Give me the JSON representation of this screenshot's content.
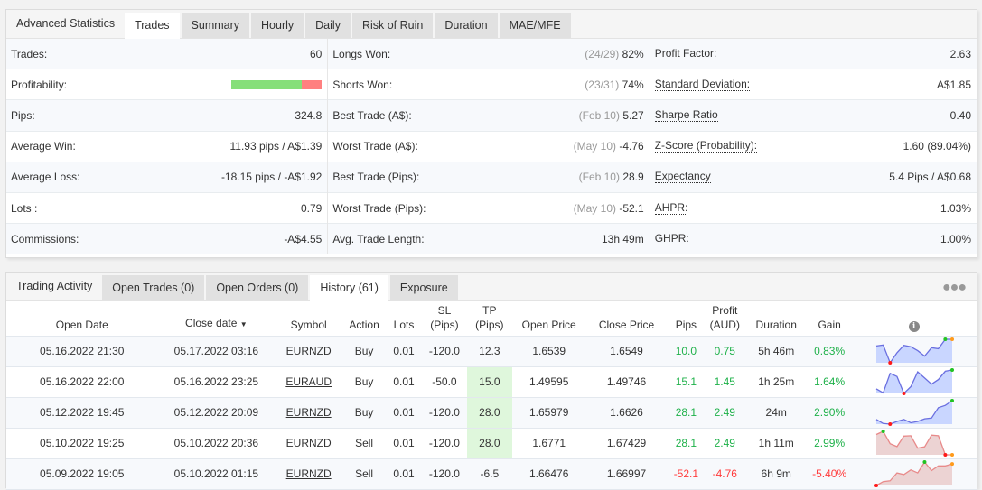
{
  "stats_panel": {
    "title": "Advanced Statistics",
    "tabs": [
      "Trades",
      "Summary",
      "Hourly",
      "Daily",
      "Risk of Ruin",
      "Duration",
      "MAE/MFE"
    ],
    "active_tab": "Trades",
    "col1": [
      {
        "label": "Trades:",
        "value": "60"
      },
      {
        "label": "Profitability:",
        "win_fraction": 0.78
      },
      {
        "label": "Pips:",
        "value": "324.8"
      },
      {
        "label": "Average Win:",
        "value": "11.93 pips / A$1.39"
      },
      {
        "label": "Average Loss:",
        "value": "-18.15 pips / -A$1.92"
      },
      {
        "label": "Lots :",
        "value": "0.79"
      },
      {
        "label": "Commissions:",
        "value": "-A$4.55"
      }
    ],
    "col2": [
      {
        "label": "Longs Won:",
        "muted": "(24/29)",
        "value": "82%"
      },
      {
        "label": "Shorts Won:",
        "muted": "(23/31)",
        "value": "74%"
      },
      {
        "label": "Best Trade (A$):",
        "muted": "(Feb 10)",
        "value": "5.27"
      },
      {
        "label": "Worst Trade (A$):",
        "muted": "(May 10)",
        "value": "-4.76"
      },
      {
        "label": "Best Trade (Pips):",
        "muted": "(Feb 10)",
        "value": "28.9"
      },
      {
        "label": "Worst Trade (Pips):",
        "muted": "(May 10)",
        "value": "-52.1"
      },
      {
        "label": "Avg. Trade Length:",
        "muted": "",
        "value": "13h 49m"
      }
    ],
    "col3": [
      {
        "label": "Profit Factor:",
        "value": "2.63"
      },
      {
        "label": "Standard Deviation:",
        "value": "A$1.85"
      },
      {
        "label": "Sharpe Ratio",
        "value": "0.40"
      },
      {
        "label": "Z-Score (Probability):",
        "value": "1.60 (89.04%)"
      },
      {
        "label": "Expectancy",
        "value": "5.4 Pips / A$0.68"
      },
      {
        "label": "AHPR:",
        "value": "1.03%"
      },
      {
        "label": "GHPR:",
        "value": "1.00%"
      }
    ]
  },
  "activity_panel": {
    "title": "Trading Activity",
    "tabs": [
      "Open Trades (0)",
      "Open Orders (0)",
      "History (61)",
      "Exposure"
    ],
    "active_tab": "History (61)",
    "more_icon": "more-dots-icon",
    "columns": {
      "open_date": "Open Date",
      "close_date": "Close date",
      "sort_indicator": "▼",
      "symbol": "Symbol",
      "action": "Action",
      "lots": "Lots",
      "sl_top": "SL",
      "sl_bottom": "(Pips)",
      "tp_top": "TP",
      "tp_bottom": "(Pips)",
      "open_price": "Open Price",
      "close_price": "Close Price",
      "pips": "Pips",
      "profit_top": "Profit",
      "profit_bottom": "(AUD)",
      "duration": "Duration",
      "gain": "Gain",
      "info_icon": "i"
    },
    "rows": [
      {
        "open_date": "05.16.2022 21:30",
        "close_date": "05.17.2022 03:16",
        "symbol": "EURNZD",
        "action": "Buy",
        "lots": "0.01",
        "sl": "-120.0",
        "tp": "12.3",
        "tp_hit": false,
        "open_price": "1.6539",
        "close_price": "1.6549",
        "pips": "10.0",
        "profit": "0.75",
        "duration": "5h 46m",
        "gain": "0.83%",
        "positive": true,
        "spark": {
          "trend": "up",
          "values": [
            6,
            6.3,
            1,
            4,
            6.2,
            5.8,
            4.6,
            3,
            5.5,
            5.2,
            8,
            8
          ],
          "min_index": 2,
          "max_index": 10,
          "last_marker": "orange"
        }
      },
      {
        "open_date": "05.16.2022 22:00",
        "close_date": "05.16.2022 23:25",
        "symbol": "EURAUD",
        "action": "Buy",
        "lots": "0.01",
        "sl": "-50.0",
        "tp": "15.0",
        "tp_hit": true,
        "open_price": "1.49595",
        "close_price": "1.49746",
        "pips": "15.1",
        "profit": "1.45",
        "duration": "1h 25m",
        "gain": "1.64%",
        "positive": true,
        "spark": {
          "trend": "up",
          "values": [
            2.5,
            1.2,
            7.5,
            6.5,
            1,
            3.2,
            8,
            6,
            4,
            5.5,
            8.2,
            8.6
          ],
          "min_index": 4,
          "max_index": 11,
          "last_marker": "green"
        }
      },
      {
        "open_date": "05.12.2022 19:45",
        "close_date": "05.12.2022 20:09",
        "symbol": "EURNZD",
        "action": "Buy",
        "lots": "0.01",
        "sl": "-120.0",
        "tp": "28.0",
        "tp_hit": true,
        "open_price": "1.65979",
        "close_price": "1.6626",
        "pips": "28.1",
        "profit": "2.49",
        "duration": "24m",
        "gain": "2.90%",
        "positive": true,
        "spark": {
          "trend": "up",
          "values": [
            2,
            0.8,
            0.6,
            1.4,
            2,
            1,
            1.4,
            2.2,
            2.4,
            5.5,
            6.2,
            7.6
          ],
          "min_index": 2,
          "max_index": 11,
          "last_marker": "green"
        }
      },
      {
        "open_date": "05.10.2022 19:25",
        "close_date": "05.10.2022 20:36",
        "symbol": "EURNZD",
        "action": "Sell",
        "lots": "0.01",
        "sl": "-120.0",
        "tp": "28.0",
        "tp_hit": true,
        "open_price": "1.6771",
        "close_price": "1.67429",
        "pips": "28.1",
        "profit": "2.49",
        "duration": "1h 11m",
        "gain": "2.99%",
        "positive": true,
        "spark": {
          "trend": "down",
          "values": [
            6.8,
            7.8,
            3.9,
            3,
            6.3,
            6.4,
            2.5,
            2.9,
            6.6,
            6.4,
            0.4,
            0.4
          ],
          "min_index": 10,
          "max_index": 1,
          "last_marker": "orange"
        }
      },
      {
        "open_date": "05.09.2022 19:05",
        "close_date": "05.10.2022 01:15",
        "symbol": "EURNZD",
        "action": "Sell",
        "lots": "0.01",
        "sl": "-120.0",
        "tp": "-6.5",
        "tp_hit": false,
        "open_price": "1.66476",
        "close_price": "1.66997",
        "pips": "-52.1",
        "profit": "-4.76",
        "duration": "6h 9m",
        "gain": "-5.40%",
        "positive": false,
        "spark": {
          "trend": "down",
          "values": [
            0,
            1,
            1.2,
            3.2,
            2.8,
            4,
            3.2,
            6,
            3.8,
            5,
            5,
            5.5
          ],
          "min_index": 0,
          "max_index": 7,
          "last_marker": "orange"
        }
      }
    ]
  },
  "colors": {
    "positive": "#1fb14a",
    "negative": "#ff3b3b",
    "spark_up_line": "#6a6fe0",
    "spark_up_fill": "#c9d6ff",
    "spark_down_line": "#e88a8a",
    "spark_down_fill": "#ecd3d3",
    "marker_min": "#ff1a1a",
    "marker_max": "#22c322",
    "marker_last": "#ff9a1a",
    "profit_win": "#86df7a",
    "profit_loss": "#ff8080",
    "tp_hit_bg": "#dff7dc"
  }
}
